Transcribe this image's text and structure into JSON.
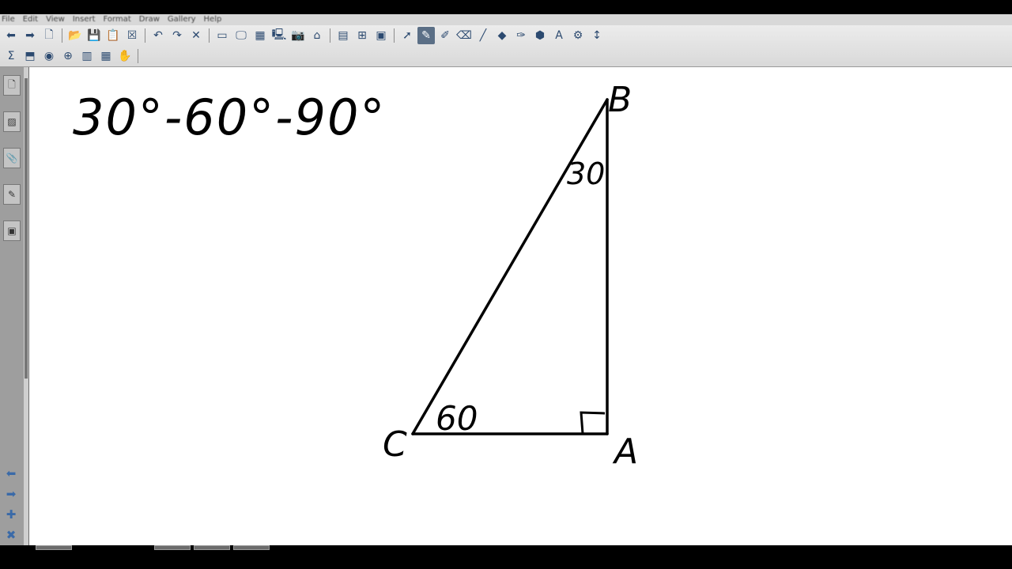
{
  "menu": [
    "File",
    "Edit",
    "View",
    "Insert",
    "Format",
    "Draw",
    "Gallery",
    "Help"
  ],
  "toolbar": {
    "row1": [
      {
        "icon": "back-arrow-icon",
        "glyph": "⬅"
      },
      {
        "icon": "forward-arrow-icon",
        "glyph": "➡"
      },
      {
        "icon": "add-page-icon",
        "glyph": "🗋"
      },
      {
        "icon": "open-folder-icon",
        "glyph": "📂"
      },
      {
        "icon": "save-icon",
        "glyph": "💾"
      },
      {
        "icon": "paste-icon",
        "glyph": "📋"
      },
      {
        "icon": "clear-page-icon",
        "glyph": "☒"
      },
      {
        "icon": "undo-icon",
        "glyph": "↶"
      },
      {
        "icon": "redo-icon",
        "glyph": "↷"
      },
      {
        "icon": "delete-icon",
        "glyph": "✕"
      },
      {
        "icon": "screen-shade-icon",
        "glyph": "▭"
      },
      {
        "icon": "display-icon",
        "glyph": "🖵"
      },
      {
        "icon": "checkerboard-icon",
        "glyph": "▦"
      },
      {
        "icon": "monitor-icon",
        "glyph": "🖳"
      },
      {
        "icon": "camera-icon",
        "glyph": "📷"
      },
      {
        "icon": "projector-icon",
        "glyph": "⌂"
      },
      {
        "icon": "table-icon",
        "glyph": "▤"
      },
      {
        "icon": "insert-icon",
        "glyph": "⊞"
      },
      {
        "icon": "widget-icon",
        "glyph": "▣"
      },
      {
        "icon": "select-arrow-icon",
        "glyph": "➚"
      },
      {
        "icon": "pen-icon",
        "glyph": "✎"
      },
      {
        "icon": "creative-pen-icon",
        "glyph": "✐"
      },
      {
        "icon": "eraser-icon",
        "glyph": "⌫"
      },
      {
        "icon": "line-icon",
        "glyph": "╱"
      },
      {
        "icon": "fill-icon",
        "glyph": "◆"
      },
      {
        "icon": "magic-pen-icon",
        "glyph": "✑"
      },
      {
        "icon": "shape-icon",
        "glyph": "⬢"
      },
      {
        "icon": "text-icon",
        "glyph": "A"
      },
      {
        "icon": "properties-icon",
        "glyph": "⚙"
      },
      {
        "icon": "expand-toolbar-icon",
        "glyph": "↕"
      }
    ],
    "row2": [
      {
        "icon": "sum-icon",
        "glyph": "Σ"
      },
      {
        "icon": "capture-icon",
        "glyph": "⬒"
      },
      {
        "icon": "fill-bucket-icon",
        "glyph": "◉"
      },
      {
        "icon": "globe-icon",
        "glyph": "⊕"
      },
      {
        "icon": "document-icon",
        "glyph": "▥"
      },
      {
        "icon": "grid-icon",
        "glyph": "▦"
      },
      {
        "icon": "hand-icon",
        "glyph": "✋"
      }
    ]
  },
  "sidebar": {
    "tabs": [
      {
        "icon": "page-sorter-icon",
        "glyph": "🗋"
      },
      {
        "icon": "gallery-icon",
        "glyph": "▨"
      },
      {
        "icon": "attachments-icon",
        "glyph": "📎"
      },
      {
        "icon": "properties-tab-icon",
        "glyph": "✎"
      },
      {
        "icon": "addons-icon",
        "glyph": "▣"
      }
    ],
    "nav": [
      {
        "icon": "previous-page-icon",
        "glyph": "⬅"
      },
      {
        "icon": "next-page-icon",
        "glyph": "➡"
      },
      {
        "icon": "add-page-bottom-icon",
        "glyph": "✚"
      },
      {
        "icon": "delete-page-icon",
        "glyph": "✖"
      }
    ]
  },
  "canvas": {
    "title": "30°-60°-90°",
    "vertices": {
      "a": "A",
      "b": "B",
      "c": "C"
    },
    "angles": {
      "b": "30",
      "c": "60"
    }
  }
}
